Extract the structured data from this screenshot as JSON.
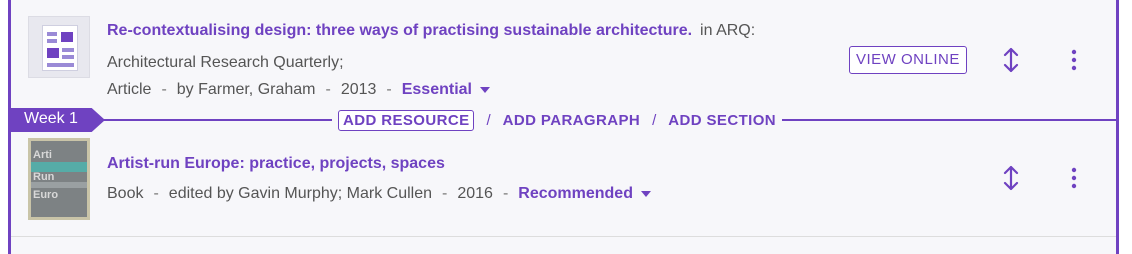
{
  "items": [
    {
      "title": "Re-contextualising design: three ways of practising sustainable architecture.",
      "in_prefix": "in ARQ:",
      "journal": "Architectural Research Quarterly;",
      "type": "Article",
      "author": "by Farmer, Graham",
      "year": "2013",
      "importance": "Essential",
      "view_online": "VIEW ONLINE",
      "thumb_icon": "document-icon"
    },
    {
      "title": "Artist-run Europe: practice, projects, spaces",
      "type": "Book",
      "author": "edited by Gavin Murphy; Mark Cullen",
      "year": "2016",
      "importance": "Recommended",
      "thumb_icon": "book-cover-image"
    }
  ],
  "section": {
    "label": "Week 1",
    "actions": [
      "ADD RESOURCE",
      "/",
      "ADD PARAGRAPH",
      "/",
      "ADD SECTION"
    ]
  },
  "colors": {
    "accent": "#6f42c1",
    "text": "#555555",
    "background": "#f7f7fa"
  }
}
